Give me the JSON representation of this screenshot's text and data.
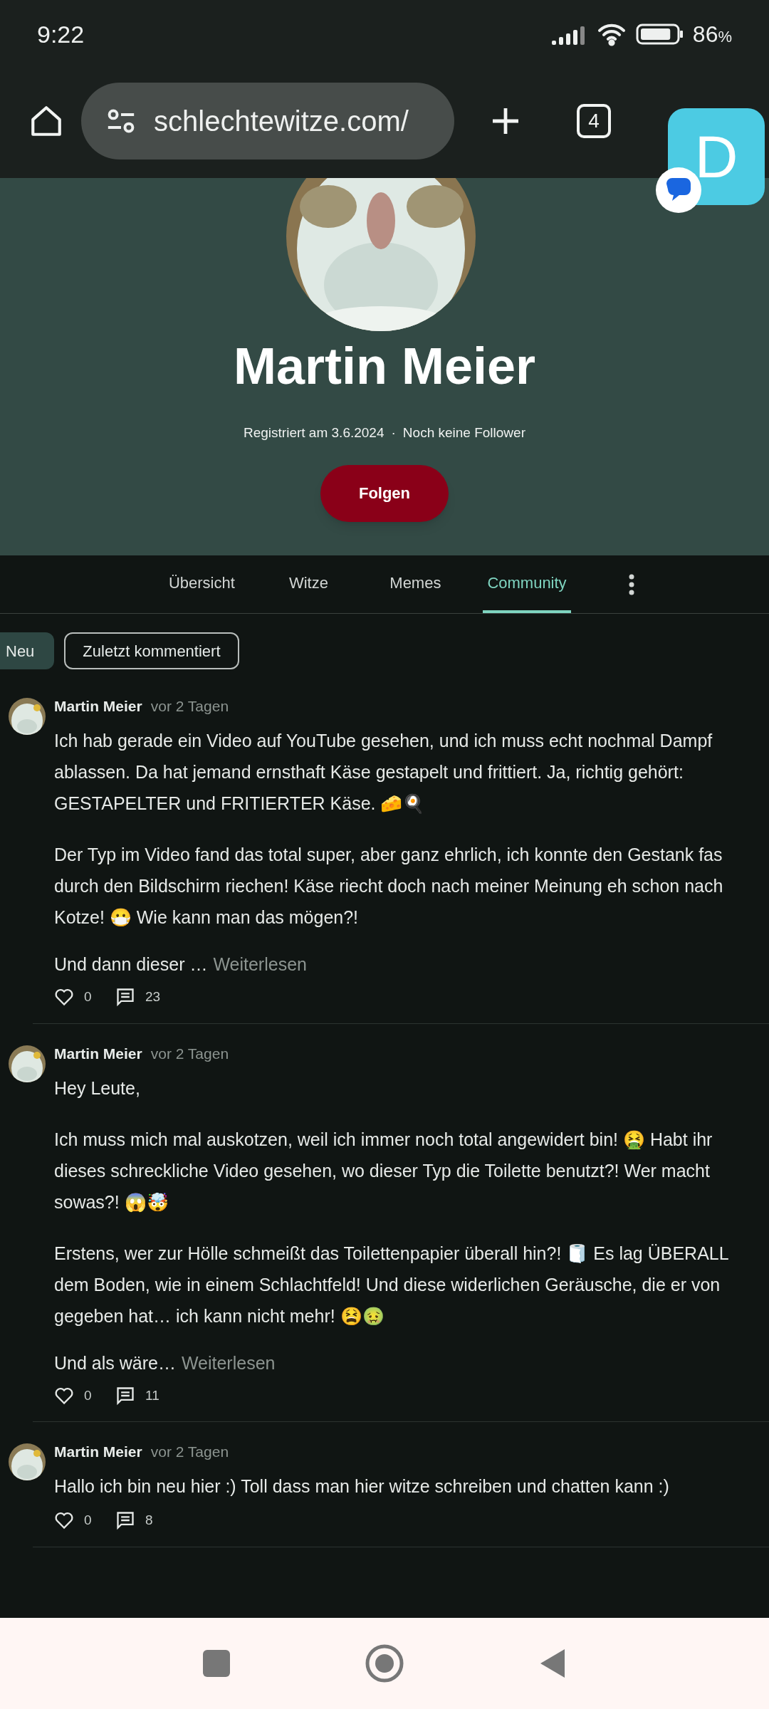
{
  "status_bar": {
    "time": "9:22",
    "battery": "86",
    "percent_sign": "%"
  },
  "browser": {
    "url": "schlechtewitze.com/",
    "tab_count": "4"
  },
  "chat_bubble": {
    "letter": "D"
  },
  "profile": {
    "name": "Martin Meier",
    "registered": "Registriert am 3.6.2024",
    "separator": "·",
    "followers": "Noch keine Follower",
    "follow_button": "Folgen"
  },
  "tabs": [
    {
      "label": "Übersicht",
      "selected": false
    },
    {
      "label": "Witze",
      "selected": false
    },
    {
      "label": "Memes",
      "selected": false
    },
    {
      "label": "Community",
      "selected": true
    }
  ],
  "filters": [
    {
      "label": "Neu",
      "selected": true
    },
    {
      "label": "Zuletzt kommentiert",
      "selected": false
    }
  ],
  "posts": [
    {
      "author": "Martin Meier",
      "time": "vor 2 Tagen",
      "paragraphs": [
        [
          "Ich hab gerade ein Video auf YouTube gesehen, und ich muss echt nochmal Dampf",
          "ablassen. Da hat jemand ernsthaft Käse gestapelt und frittiert. Ja, richtig gehört:",
          "GESTAPELTER und FRITIERTER Käse. 🧀🍳"
        ],
        [
          "Der Typ im Video fand das total super, aber ganz ehrlich, ich konnte den Gestank fas",
          "durch den Bildschirm riechen! Käse riecht doch nach meiner Meinung eh schon nach",
          "Kotze! 😷 Wie kann man das mögen?!"
        ]
      ],
      "teaser": "Und dann dieser …",
      "read_more": "Weiterlesen",
      "likes": "0",
      "comments": "23"
    },
    {
      "author": "Martin Meier",
      "time": "vor 2 Tagen",
      "paragraphs": [
        [
          "Hey Leute,"
        ],
        [
          "Ich muss mich mal auskotzen, weil ich immer noch total angewidert bin! 🤮 Habt ihr",
          "dieses schreckliche Video gesehen, wo dieser Typ die Toilette benutzt?! Wer macht",
          "sowas?! 😱🤯"
        ],
        [
          "Erstens, wer zur Hölle schmeißt das Toilettenpapier überall hin?! 🧻 Es lag ÜBERALL",
          "dem Boden, wie in einem Schlachtfeld! Und diese widerlichen Geräusche, die er von",
          "gegeben hat… ich kann nicht mehr! 😫🤢"
        ]
      ],
      "teaser": "Und als wäre…",
      "read_more": "Weiterlesen",
      "likes": "0",
      "comments": "11"
    },
    {
      "author": "Martin Meier",
      "time": "vor 2 Tagen",
      "paragraphs": [
        [
          "Hallo ich bin neu hier :) Toll dass man hier witze schreiben und chatten kann :)"
        ]
      ],
      "likes": "0",
      "comments": "8"
    }
  ]
}
